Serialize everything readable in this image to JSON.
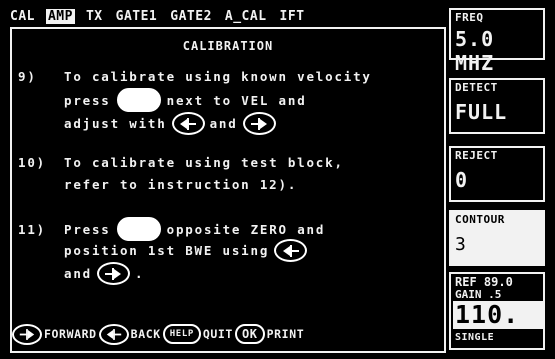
{
  "top_menu": {
    "items": [
      "CAL",
      "AMP",
      "TX",
      "GATE1",
      "GATE2",
      "A_CAL",
      "IFT"
    ],
    "active_item": "AMP"
  },
  "dialog": {
    "title": "CALIBRATION",
    "step9": {
      "number": "9)",
      "line1": "To calibrate using known velocity",
      "line2a": "press",
      "line2b": "next to VEL and",
      "line3a": "adjust with",
      "line3b": "and"
    },
    "step10": {
      "number": "10)",
      "line1": "To calibrate using test block,",
      "line2": "refer to instruction 12)."
    },
    "step11": {
      "number": "11)",
      "line1a": "Press",
      "line1b": "opposite ZERO and",
      "line2": "position 1st BWE using",
      "line3a": "and",
      "line3b": "."
    }
  },
  "bottom_bar": {
    "forward_label": "FORWARD",
    "back_label": "BACK",
    "help_key": "HELP",
    "quit_label": "QUIT",
    "ok_key": "OK",
    "print_label": "PRINT"
  },
  "right_panels": {
    "freq": {
      "label": "FREQ",
      "value": "5.0 MHZ"
    },
    "detect": {
      "label": "DETECT",
      "value": "FULL"
    },
    "reject": {
      "label": "REJECT",
      "value": "0"
    },
    "contour": {
      "label": "CONTOUR",
      "value": "3"
    },
    "gain": {
      "ref_line": "REF 89.0",
      "gain_line": "GAIN  .5",
      "value": "110.",
      "mode": "SINGLE"
    }
  },
  "icons": {
    "forward": "arrow-right-icon",
    "back": "arrow-left-icon"
  },
  "colors": {
    "background": "#000000",
    "foreground": "#f2f2f2"
  }
}
